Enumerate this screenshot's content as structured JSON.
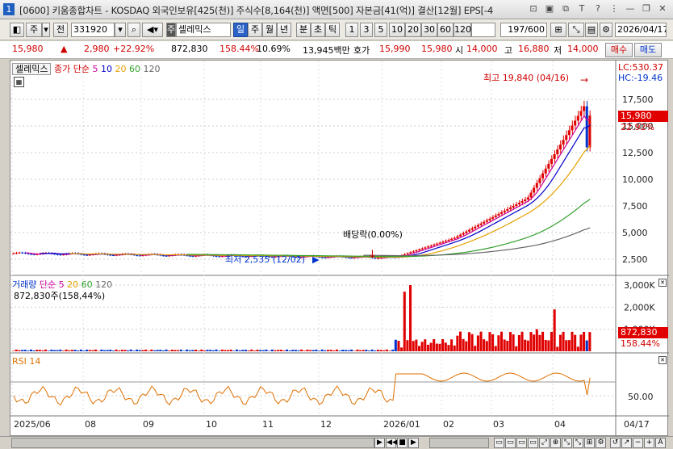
{
  "window": {
    "app_num": "1",
    "title": "[0600] 키움종합차트 - KOSDAQ 외국인보유[425(천)] 주식수[8,164(천)] 액면[500] 자본금[41(억)] 결산[12월] EPS[-4"
  },
  "toolbar": {
    "type_label": "주",
    "prev_label": "전",
    "code_value": "331920",
    "stock_name": "셀레믹스",
    "periods": [
      "일",
      "주",
      "월",
      "년",
      "분",
      "초",
      "틱"
    ],
    "selected_period": "일",
    "intervals": [
      "1",
      "3",
      "5",
      "10",
      "20",
      "30",
      "60",
      "120"
    ],
    "count_value": "197/600",
    "date_value": "2026/04/17"
  },
  "quote": {
    "price": "15,980",
    "arrow": "▲",
    "change": "2,980",
    "change_pct": "+22.92%",
    "volume": "872,830",
    "volume_ratio": "158.44%",
    "turnover_pct": "10.69%",
    "amount": "13,945백만",
    "bid_ask_label": "호가",
    "ask": "15,990",
    "bid": "15,980",
    "open_label": "시",
    "open": "14,000",
    "high_label": "고",
    "high": "16,880",
    "low_label": "저",
    "low": "14,000",
    "buy_label": "매수",
    "sell_label": "매도"
  },
  "price_pane": {
    "legend_name": "셀레믹스",
    "legend_ma": "종가 단순",
    "ma_periods": [
      "5",
      "10",
      "20",
      "60",
      "120"
    ],
    "ma_colors": [
      "#cc0099",
      "#0000cc",
      "#e6a000",
      "#33a02c",
      "#666666"
    ],
    "lc_label": "LC:530.37",
    "hc_label": "HC:-19.46",
    "high_annotation": "최고 19,840 (04/16)",
    "low_annotation": "최저 2,535 (12/02)",
    "dividend_annotation": "배당락(0.00%)",
    "current_price_tag": "15,980",
    "current_pct_tag": "22.92%",
    "y_ticks": [
      "17,500",
      "15,000",
      "12,500",
      "10,000",
      "7,500",
      "5,000",
      "2,500"
    ]
  },
  "volume_pane": {
    "legend": "거래량",
    "legend_ma": "단순",
    "ma_periods": [
      "5",
      "20",
      "60",
      "120"
    ],
    "sub_label": "872,830주(158,44%)",
    "current_tag": "872,830",
    "current_pct": "158.44%",
    "y_ticks": [
      "3,000K",
      "2,000K",
      "1,000K"
    ]
  },
  "rsi_pane": {
    "legend": "RSI 14",
    "y_tick": "50.00"
  },
  "x_axis": {
    "labels": [
      "2025/06",
      "08",
      "09",
      "10",
      "11",
      "12",
      "2026/01",
      "02",
      "03",
      "04"
    ],
    "right_label": "04/17"
  },
  "colors": {
    "up": "#e00000",
    "down": "#0033cc",
    "rsi": "#e07000"
  }
}
